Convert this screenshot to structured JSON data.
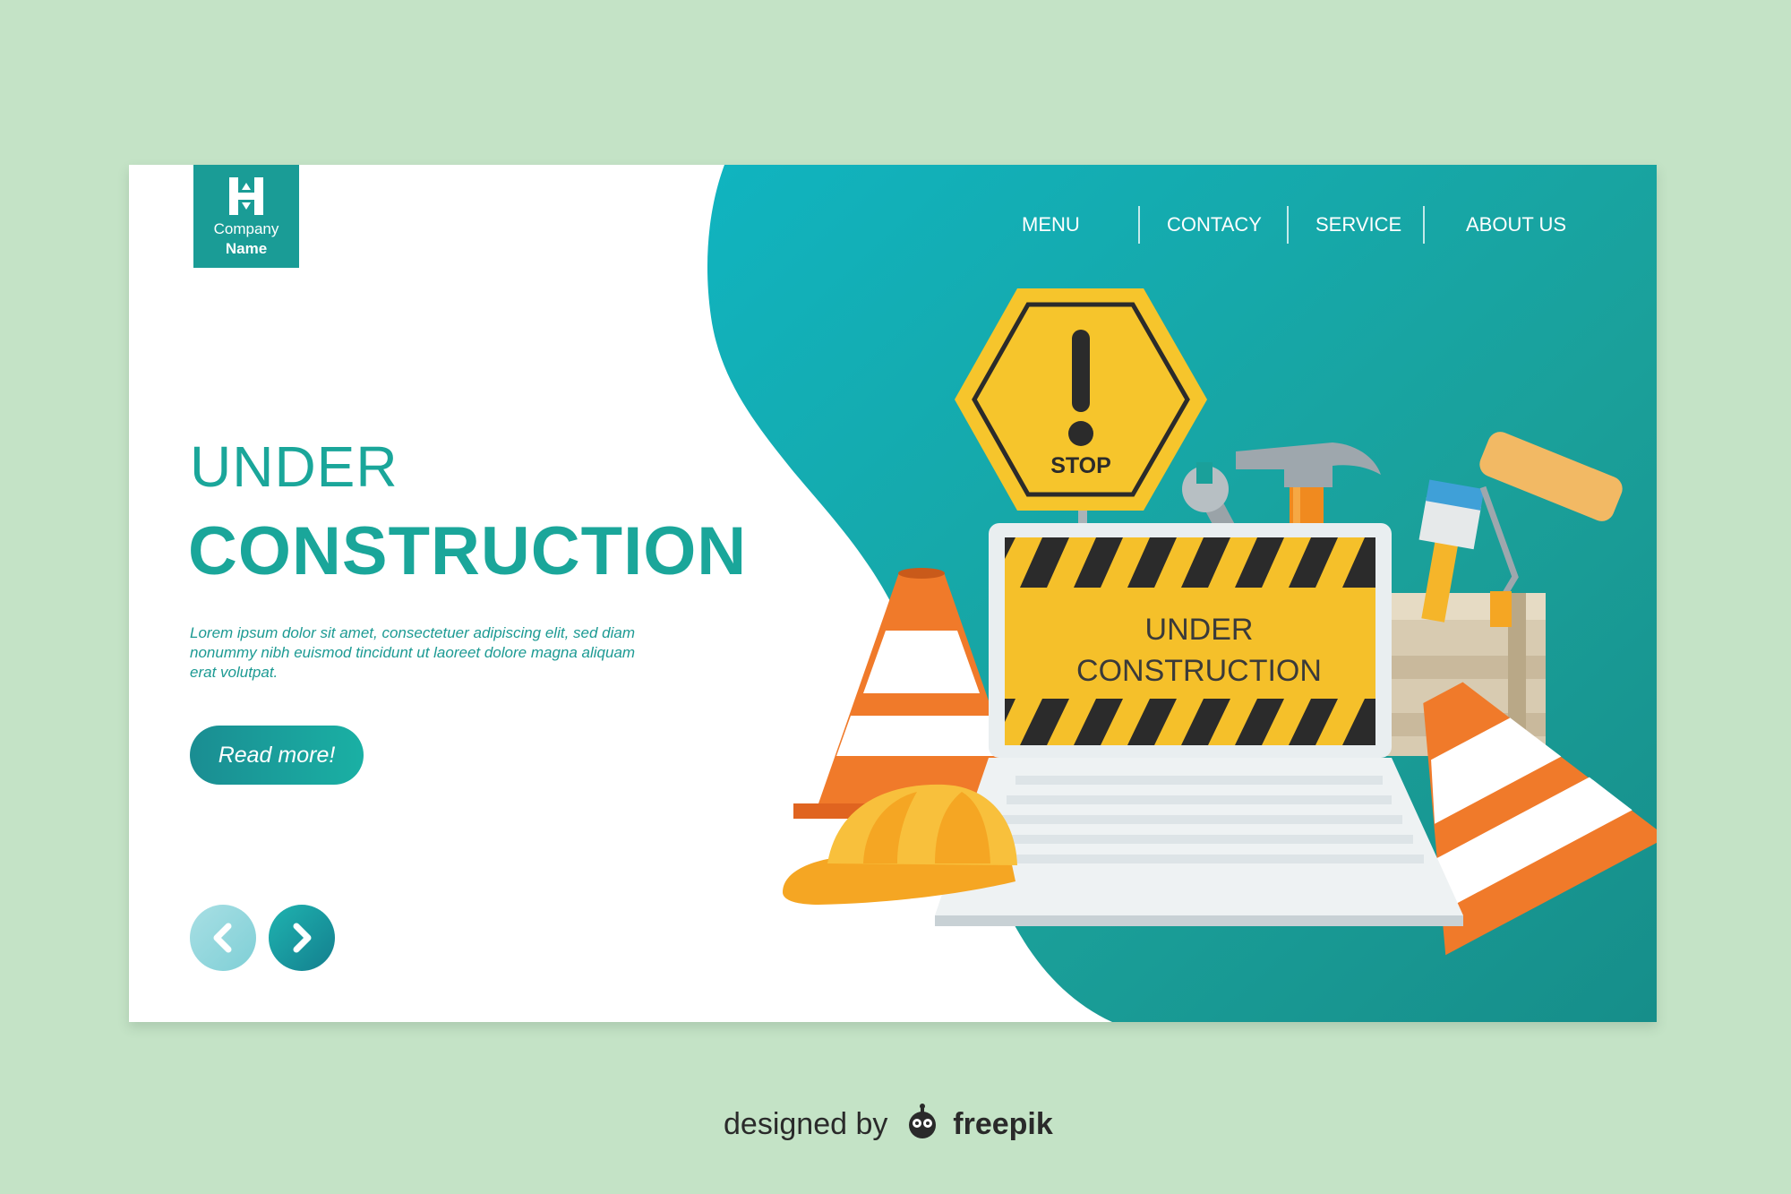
{
  "brand": {
    "company_line1": "Company",
    "company_line2": "Name",
    "logo_icon": "H-logo-icon"
  },
  "nav": {
    "items": [
      {
        "label": "MENU"
      },
      {
        "label": "CONTACY"
      },
      {
        "label": "SERVICE"
      },
      {
        "label": "ABOUT US"
      }
    ]
  },
  "hero": {
    "title_line1": "UNDER",
    "title_line2": "CONSTRUCTION",
    "body": "Lorem ipsum dolor sit amet, consectetuer adipiscing elit, sed diam nonummy nibh euismod tincidunt ut laoreet dolore magna aliquam erat volutpat.",
    "cta_label": "Read more!"
  },
  "illustration": {
    "sign_text": "STOP",
    "laptop_line1": "UNDER",
    "laptop_line2": "CONSTRUCTION"
  },
  "pager": {
    "prev_icon": "chevron-left-icon",
    "next_icon": "chevron-right-icon"
  },
  "credit": {
    "prefix": "designed by",
    "brand": "freepik"
  },
  "colors": {
    "page_bg": "#c4e3c6",
    "teal": "#1aa69a",
    "teal_dark": "#137f8e",
    "sign_yellow": "#f6c52c",
    "cone_orange": "#f07a2a"
  }
}
